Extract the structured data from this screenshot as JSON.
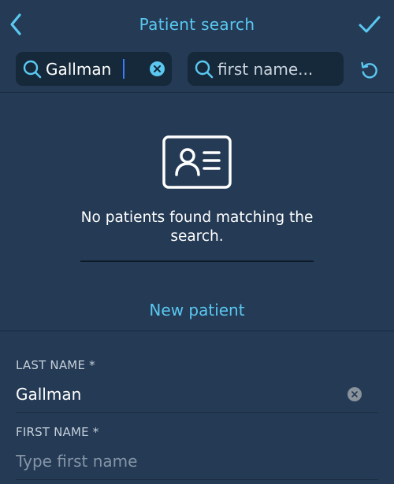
{
  "header": {
    "title": "Patient search",
    "back_icon": "chevron-left-icon",
    "confirm_icon": "checkmark-icon"
  },
  "search": {
    "last_name_value": "Gallman",
    "first_name_placeholder": "first name..."
  },
  "empty_state": {
    "icon": "id-card-icon",
    "message": "No patients found matching the search."
  },
  "new_patient": {
    "label": "New patient"
  },
  "form": {
    "last_name_label": "LAST NAME *",
    "last_name_value": "Gallman",
    "first_name_label": "FIRST NAME *",
    "first_name_placeholder": "Type first name"
  },
  "colors": {
    "background": "#243a55",
    "accent": "#5ac8f0",
    "field_bg": "#16293a"
  }
}
